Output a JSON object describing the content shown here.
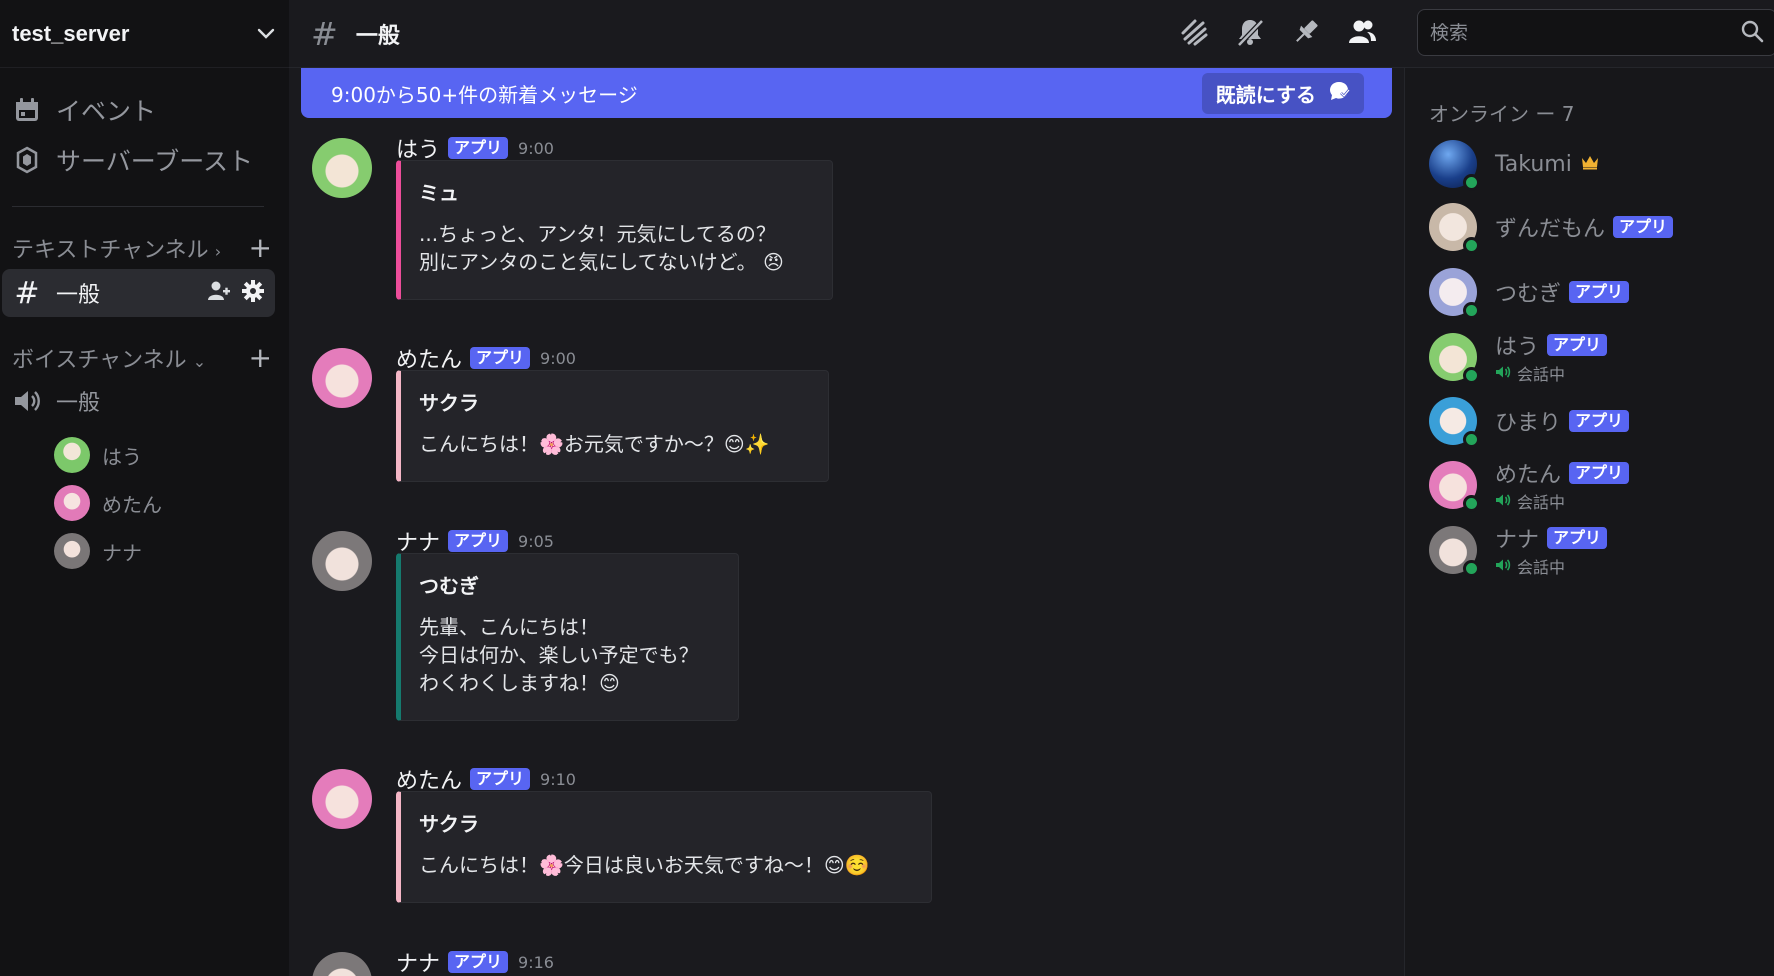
{
  "colors": {
    "accent": "#5865f2",
    "online": "#23a55a",
    "crown": "#f0b132",
    "embed_pink": "#ed4d9a",
    "embed_lightpink": "#f4b6c6",
    "embed_teal": "#157a6e"
  },
  "sidebar": {
    "server_name": "test_server",
    "items": [
      {
        "label": "イベント",
        "icon": "calendar-icon"
      },
      {
        "label": "サーバーブースト",
        "icon": "boost-icon"
      }
    ],
    "text_category": "テキストチャンネル",
    "active_channel": "一般",
    "voice_category": "ボイスチャンネル",
    "voice_channel": "一般",
    "voice_users": [
      "はう",
      "めたん",
      "ナナ"
    ]
  },
  "topbar": {
    "channel": "一般",
    "search_placeholder": "検索",
    "icons": [
      "threads-icon",
      "mute-bell-icon",
      "pin-icon",
      "members-icon"
    ]
  },
  "banner": {
    "text": "9:00から50+件の新着メッセージ",
    "mark_read": "既読にする"
  },
  "badge_label": "アプリ",
  "messages": [
    {
      "user": "はう",
      "time": "9:00",
      "embed_title": "ミュ",
      "embed_text": "...ちょっと、アンタ！元気にしてるの？\n別にアンタのこと気にしてないけど。",
      "emoji": "😠"
    },
    {
      "user": "めたん",
      "time": "9:00",
      "embed_title": "サクラ",
      "embed_text": "こんにちは！🌸お元気ですか～？",
      "emoji": "😊✨"
    },
    {
      "user": "ナナ",
      "time": "9:05",
      "embed_title": "つむぎ",
      "embed_text": "先輩、こんにちは！\n今日は何か、楽しい予定でも？\nわくわくしますね！",
      "emoji": "😊"
    },
    {
      "user": "めたん",
      "time": "9:10",
      "embed_title": "サクラ",
      "embed_text": "こんにちは！🌸今日は良いお天気ですね～！",
      "emoji": "😊☺️"
    },
    {
      "user": "ナナ",
      "time": "9:16"
    }
  ],
  "members": {
    "header": "オンライン ー 7",
    "list": [
      {
        "name": "Takumi",
        "owner": true
      },
      {
        "name": "ずんだもん",
        "app": true
      },
      {
        "name": "つむぎ",
        "app": true
      },
      {
        "name": "はう",
        "app": true,
        "status": "会話中"
      },
      {
        "name": "ひまり",
        "app": true
      },
      {
        "name": "めたん",
        "app": true,
        "status": "会話中"
      },
      {
        "name": "ナナ",
        "app": true,
        "status": "会話中"
      }
    ]
  }
}
